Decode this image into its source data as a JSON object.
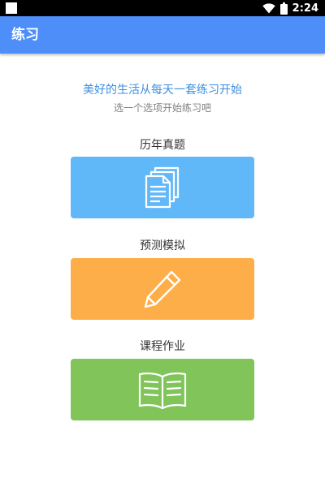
{
  "status_bar": {
    "time": "2:24",
    "icons": [
      "notification-square-icon",
      "wifi-icon",
      "battery-icon"
    ]
  },
  "app_bar": {
    "title": "练习",
    "color": "#4d8ef8"
  },
  "intro": {
    "slogan": "美好的生活从每天一套练习开始",
    "hint": "选一个选项开始练习吧"
  },
  "options": [
    {
      "label": "历年真题",
      "icon": "documents-icon",
      "color": "#61b8f9"
    },
    {
      "label": "预测模拟",
      "icon": "pencil-icon",
      "color": "#fdae49"
    },
    {
      "label": "课程作业",
      "icon": "open-book-icon",
      "color": "#80c45a"
    }
  ]
}
